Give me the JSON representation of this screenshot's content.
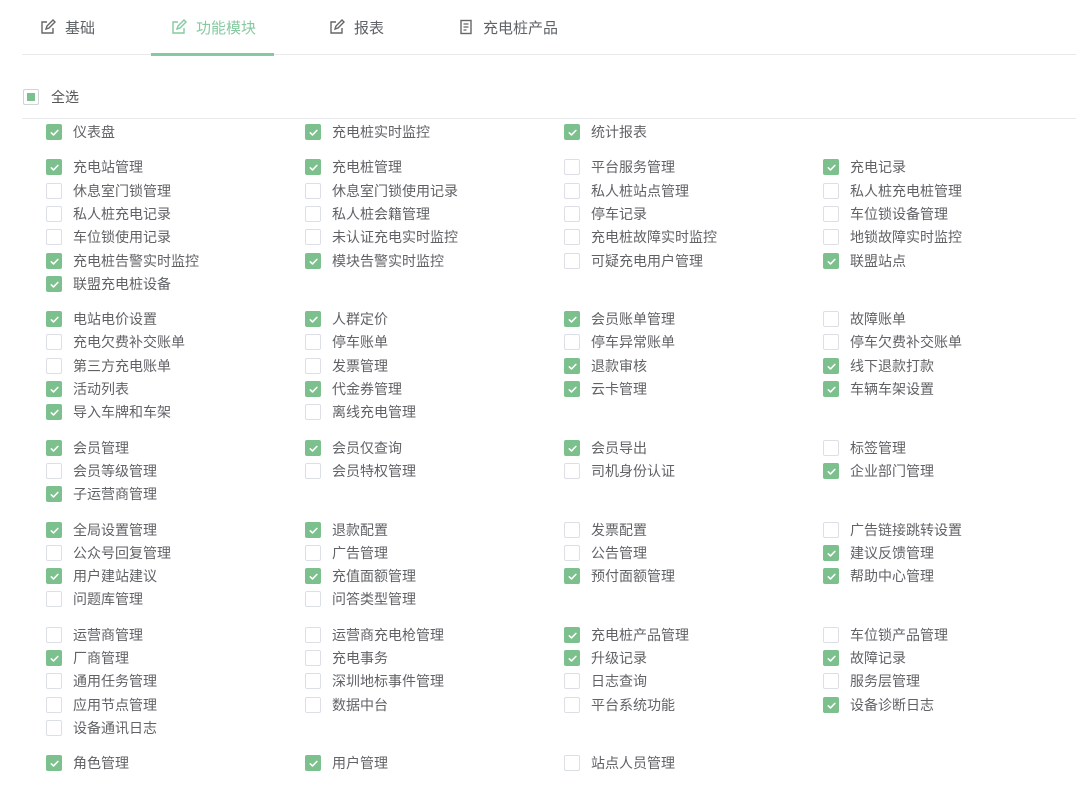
{
  "tabs": [
    {
      "label": "基础",
      "icon": "edit-icon",
      "active": false
    },
    {
      "label": "功能模块",
      "icon": "edit-icon",
      "active": true
    },
    {
      "label": "报表",
      "icon": "edit-icon",
      "active": false
    },
    {
      "label": "充电桩产品",
      "icon": "document-icon",
      "active": false
    }
  ],
  "select_all": {
    "label": "全选",
    "state": "partial"
  },
  "colors": {
    "accent": "#7cc08e",
    "tab_active": "#86c9a0",
    "text": "#606266",
    "border": "#dcdfe6"
  },
  "groups": [
    [
      [
        {
          "label": "仪表盘",
          "checked": true
        },
        {
          "label": "充电桩实时监控",
          "checked": true
        },
        {
          "label": "统计报表",
          "checked": true
        }
      ]
    ],
    [
      [
        {
          "label": "充电站管理",
          "checked": true
        },
        {
          "label": "充电桩管理",
          "checked": true
        },
        {
          "label": "平台服务管理",
          "checked": false
        },
        {
          "label": "充电记录",
          "checked": true
        }
      ],
      [
        {
          "label": "休息室门锁管理",
          "checked": false
        },
        {
          "label": "休息室门锁使用记录",
          "checked": false
        },
        {
          "label": "私人桩站点管理",
          "checked": false
        },
        {
          "label": "私人桩充电桩管理",
          "checked": false
        }
      ],
      [
        {
          "label": "私人桩充电记录",
          "checked": false
        },
        {
          "label": "私人桩会籍管理",
          "checked": false
        },
        {
          "label": "停车记录",
          "checked": false
        },
        {
          "label": "车位锁设备管理",
          "checked": false
        }
      ],
      [
        {
          "label": "车位锁使用记录",
          "checked": false
        },
        {
          "label": "未认证充电实时监控",
          "checked": false
        },
        {
          "label": "充电桩故障实时监控",
          "checked": false
        },
        {
          "label": "地锁故障实时监控",
          "checked": false
        }
      ],
      [
        {
          "label": "充电桩告警实时监控",
          "checked": true
        },
        {
          "label": "模块告警实时监控",
          "checked": true
        },
        {
          "label": "可疑充电用户管理",
          "checked": false
        },
        {
          "label": "联盟站点",
          "checked": true
        }
      ],
      [
        {
          "label": "联盟充电桩设备",
          "checked": true
        }
      ]
    ],
    [
      [
        {
          "label": "电站电价设置",
          "checked": true
        },
        {
          "label": "人群定价",
          "checked": true
        },
        {
          "label": "会员账单管理",
          "checked": true
        },
        {
          "label": "故障账单",
          "checked": false
        }
      ],
      [
        {
          "label": "充电欠费补交账单",
          "checked": false
        },
        {
          "label": "停车账单",
          "checked": false
        },
        {
          "label": "停车异常账单",
          "checked": false
        },
        {
          "label": "停车欠费补交账单",
          "checked": false
        }
      ],
      [
        {
          "label": "第三方充电账单",
          "checked": false
        },
        {
          "label": "发票管理",
          "checked": false
        },
        {
          "label": "退款审核",
          "checked": true
        },
        {
          "label": "线下退款打款",
          "checked": true
        }
      ],
      [
        {
          "label": "活动列表",
          "checked": true
        },
        {
          "label": "代金券管理",
          "checked": true
        },
        {
          "label": "云卡管理",
          "checked": true
        },
        {
          "label": "车辆车架设置",
          "checked": true
        }
      ],
      [
        {
          "label": "导入车牌和车架",
          "checked": true
        },
        {
          "label": "离线充电管理",
          "checked": false
        }
      ]
    ],
    [
      [
        {
          "label": "会员管理",
          "checked": true
        },
        {
          "label": "会员仅查询",
          "checked": true
        },
        {
          "label": "会员导出",
          "checked": true
        },
        {
          "label": "标签管理",
          "checked": false
        }
      ],
      [
        {
          "label": "会员等级管理",
          "checked": false
        },
        {
          "label": "会员特权管理",
          "checked": false
        },
        {
          "label": "司机身份认证",
          "checked": false
        },
        {
          "label": "企业部门管理",
          "checked": true
        }
      ],
      [
        {
          "label": "子运营商管理",
          "checked": true
        }
      ]
    ],
    [
      [
        {
          "label": "全局设置管理",
          "checked": true
        },
        {
          "label": "退款配置",
          "checked": true
        },
        {
          "label": "发票配置",
          "checked": false
        },
        {
          "label": "广告链接跳转设置",
          "checked": false
        }
      ],
      [
        {
          "label": "公众号回复管理",
          "checked": false
        },
        {
          "label": "广告管理",
          "checked": false
        },
        {
          "label": "公告管理",
          "checked": false
        },
        {
          "label": "建议反馈管理",
          "checked": true
        }
      ],
      [
        {
          "label": "用户建站建议",
          "checked": true
        },
        {
          "label": "充值面额管理",
          "checked": true
        },
        {
          "label": "预付面额管理",
          "checked": true
        },
        {
          "label": "帮助中心管理",
          "checked": true
        }
      ],
      [
        {
          "label": "问题库管理",
          "checked": false
        },
        {
          "label": "问答类型管理",
          "checked": false
        }
      ]
    ],
    [
      [
        {
          "label": "运营商管理",
          "checked": false
        },
        {
          "label": "运营商充电枪管理",
          "checked": false
        },
        {
          "label": "充电桩产品管理",
          "checked": true
        },
        {
          "label": "车位锁产品管理",
          "checked": false
        }
      ],
      [
        {
          "label": "厂商管理",
          "checked": true
        },
        {
          "label": "充电事务",
          "checked": false
        },
        {
          "label": "升级记录",
          "checked": true
        },
        {
          "label": "故障记录",
          "checked": true
        }
      ],
      [
        {
          "label": "通用任务管理",
          "checked": false
        },
        {
          "label": "深圳地标事件管理",
          "checked": false
        },
        {
          "label": "日志查询",
          "checked": false
        },
        {
          "label": "服务层管理",
          "checked": false
        }
      ],
      [
        {
          "label": "应用节点管理",
          "checked": false
        },
        {
          "label": "数据中台",
          "checked": false
        },
        {
          "label": "平台系统功能",
          "checked": false
        },
        {
          "label": "设备诊断日志",
          "checked": true
        }
      ],
      [
        {
          "label": "设备通讯日志",
          "checked": false
        }
      ]
    ],
    [
      [
        {
          "label": "角色管理",
          "checked": true
        },
        {
          "label": "用户管理",
          "checked": true
        },
        {
          "label": "站点人员管理",
          "checked": false
        }
      ]
    ]
  ]
}
